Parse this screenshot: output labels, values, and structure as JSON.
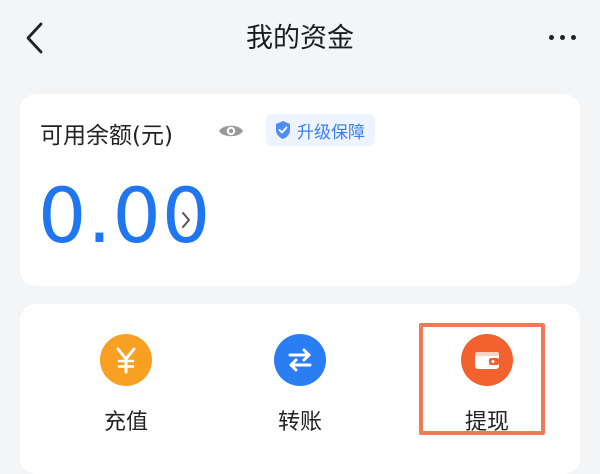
{
  "header": {
    "title": "我的资金",
    "back_icon": "chevron-left-icon",
    "more_icon": "more-horizontal-icon"
  },
  "balance": {
    "label": "可用余额(元)",
    "amount": "0.00",
    "badge_text": "升级保障",
    "amount_color": "#1f76f0"
  },
  "actions": [
    {
      "label": "充值",
      "icon": "yen-icon",
      "color": "#f7a021"
    },
    {
      "label": "转账",
      "icon": "transfer-icon",
      "color": "#2a7ef2"
    },
    {
      "label": "提现",
      "icon": "wallet-icon",
      "color": "#f2612e"
    }
  ],
  "highlight_color": "#ee7a57"
}
